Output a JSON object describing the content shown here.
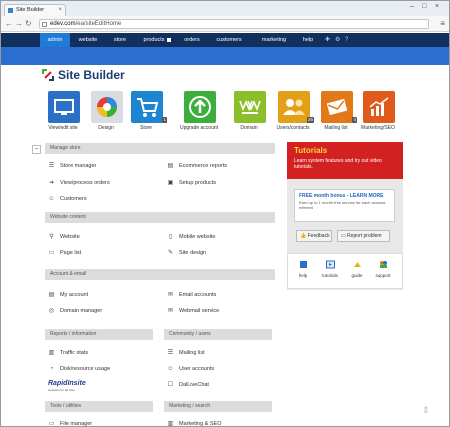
{
  "browser": {
    "tab_title": "Site Builder",
    "url_host": "edev.com",
    "url_path": "/ea/siteEditHome"
  },
  "nav": {
    "items": [
      "admin",
      "website",
      "store",
      "products",
      "orders",
      "customers",
      "marketing",
      "help"
    ],
    "active": "admin"
  },
  "logo": {
    "text": "Site Builder"
  },
  "tiles": [
    {
      "label": "View/edit site",
      "color": "#2b6fc6",
      "icon": "monitor-icon"
    },
    {
      "label": "Design",
      "color": "#d8dde2",
      "icon": "palette-icon"
    },
    {
      "label": "Store",
      "color": "#1e86d1",
      "icon": "cart-icon",
      "badge": "1"
    },
    {
      "label": "Upgrade account",
      "color": "#3cae3c",
      "icon": "up-arrow-icon"
    },
    {
      "label": "Domain",
      "color": "#8bbf2a",
      "icon": "www-icon"
    },
    {
      "label": "Users/contacts",
      "color": "#e2a018",
      "icon": "users-icon",
      "badge": "26"
    },
    {
      "label": "Mailing list",
      "color": "#e27818",
      "icon": "mail-icon",
      "badge": "4"
    },
    {
      "label": "Marketing/SEO",
      "color": "#e05a1c",
      "icon": "chart-icon"
    }
  ],
  "sections": {
    "manage_store": {
      "title": "Manage store",
      "links": [
        "Store manager",
        "Ecommerce reports",
        "View/process orders",
        "Setup products",
        "Customers"
      ]
    },
    "website_content": {
      "title": "Website content",
      "links": [
        "Website",
        "Mobile website",
        "Page list",
        "Site design"
      ]
    },
    "account_email": {
      "title": "Account & email",
      "links": [
        "My account",
        "Email accounts",
        "Domain manager",
        "Webmail service"
      ]
    },
    "reports": {
      "title": "Reports / information",
      "links": [
        "Traffic stats",
        "Disk/resource usage"
      ]
    },
    "community": {
      "title": "Community / users",
      "links": [
        "Mailing list",
        "User accounts",
        "DalLiveChat"
      ]
    },
    "tools": {
      "title": "Tools / utilities",
      "links": [
        "File manager"
      ]
    },
    "marketing": {
      "title": "Marketing / search",
      "links": [
        "Marketing & SEO"
      ]
    }
  },
  "rapid": {
    "title": "RapidInsite",
    "sub": "analytics for all sites"
  },
  "tutorials": {
    "title": "Tutorials",
    "desc": "Learn system features and try out video tutorials."
  },
  "free": {
    "title": "FREE month bonus - LEARN MORE",
    "sub": "Earn up to 1 month free service for each account referred"
  },
  "buttons": {
    "feedback": "Feedback",
    "report": "Report problem"
  },
  "help": [
    "help",
    "tutorials",
    "guide",
    "support"
  ]
}
